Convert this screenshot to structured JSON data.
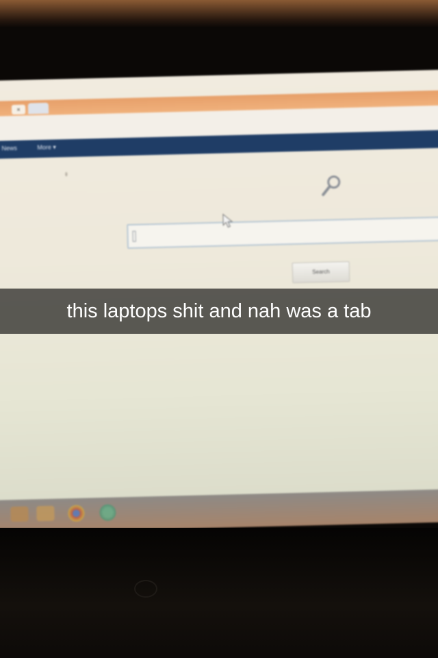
{
  "browser": {
    "tab_close_glyph": "×",
    "nav": {
      "news": "News",
      "more": "More ▾"
    }
  },
  "search": {
    "button_label": "Search",
    "input_value": ""
  },
  "caption": {
    "text": "this laptops shit and nah was a tab"
  },
  "colors": {
    "nav_bar": "#1f3d66",
    "tab_strip": "#e7a06a",
    "caption_bg": "rgba(0,0,0,0.62)"
  },
  "icons": [
    "search-icon",
    "mouse-cursor-icon",
    "chrome-icon"
  ]
}
